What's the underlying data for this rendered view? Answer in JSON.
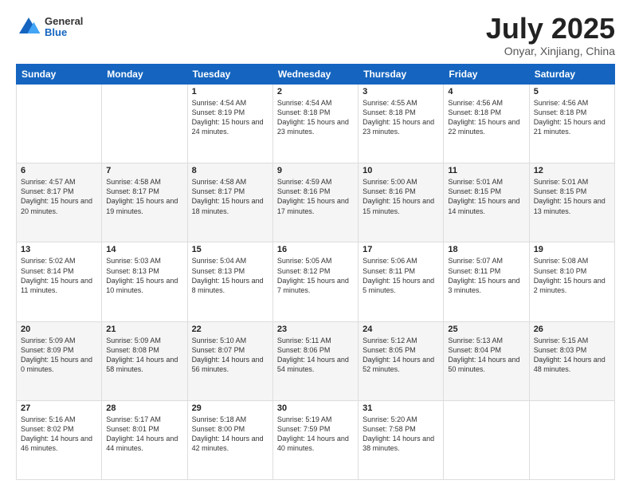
{
  "header": {
    "logo_general": "General",
    "logo_blue": "Blue",
    "month_title": "July 2025",
    "location": "Onyar, Xinjiang, China"
  },
  "weekdays": [
    "Sunday",
    "Monday",
    "Tuesday",
    "Wednesday",
    "Thursday",
    "Friday",
    "Saturday"
  ],
  "weeks": [
    [
      {
        "day": "",
        "info": ""
      },
      {
        "day": "",
        "info": ""
      },
      {
        "day": "1",
        "info": "Sunrise: 4:54 AM\nSunset: 8:19 PM\nDaylight: 15 hours and 24 minutes."
      },
      {
        "day": "2",
        "info": "Sunrise: 4:54 AM\nSunset: 8:18 PM\nDaylight: 15 hours and 23 minutes."
      },
      {
        "day": "3",
        "info": "Sunrise: 4:55 AM\nSunset: 8:18 PM\nDaylight: 15 hours and 23 minutes."
      },
      {
        "day": "4",
        "info": "Sunrise: 4:56 AM\nSunset: 8:18 PM\nDaylight: 15 hours and 22 minutes."
      },
      {
        "day": "5",
        "info": "Sunrise: 4:56 AM\nSunset: 8:18 PM\nDaylight: 15 hours and 21 minutes."
      }
    ],
    [
      {
        "day": "6",
        "info": "Sunrise: 4:57 AM\nSunset: 8:17 PM\nDaylight: 15 hours and 20 minutes."
      },
      {
        "day": "7",
        "info": "Sunrise: 4:58 AM\nSunset: 8:17 PM\nDaylight: 15 hours and 19 minutes."
      },
      {
        "day": "8",
        "info": "Sunrise: 4:58 AM\nSunset: 8:17 PM\nDaylight: 15 hours and 18 minutes."
      },
      {
        "day": "9",
        "info": "Sunrise: 4:59 AM\nSunset: 8:16 PM\nDaylight: 15 hours and 17 minutes."
      },
      {
        "day": "10",
        "info": "Sunrise: 5:00 AM\nSunset: 8:16 PM\nDaylight: 15 hours and 15 minutes."
      },
      {
        "day": "11",
        "info": "Sunrise: 5:01 AM\nSunset: 8:15 PM\nDaylight: 15 hours and 14 minutes."
      },
      {
        "day": "12",
        "info": "Sunrise: 5:01 AM\nSunset: 8:15 PM\nDaylight: 15 hours and 13 minutes."
      }
    ],
    [
      {
        "day": "13",
        "info": "Sunrise: 5:02 AM\nSunset: 8:14 PM\nDaylight: 15 hours and 11 minutes."
      },
      {
        "day": "14",
        "info": "Sunrise: 5:03 AM\nSunset: 8:13 PM\nDaylight: 15 hours and 10 minutes."
      },
      {
        "day": "15",
        "info": "Sunrise: 5:04 AM\nSunset: 8:13 PM\nDaylight: 15 hours and 8 minutes."
      },
      {
        "day": "16",
        "info": "Sunrise: 5:05 AM\nSunset: 8:12 PM\nDaylight: 15 hours and 7 minutes."
      },
      {
        "day": "17",
        "info": "Sunrise: 5:06 AM\nSunset: 8:11 PM\nDaylight: 15 hours and 5 minutes."
      },
      {
        "day": "18",
        "info": "Sunrise: 5:07 AM\nSunset: 8:11 PM\nDaylight: 15 hours and 3 minutes."
      },
      {
        "day": "19",
        "info": "Sunrise: 5:08 AM\nSunset: 8:10 PM\nDaylight: 15 hours and 2 minutes."
      }
    ],
    [
      {
        "day": "20",
        "info": "Sunrise: 5:09 AM\nSunset: 8:09 PM\nDaylight: 15 hours and 0 minutes."
      },
      {
        "day": "21",
        "info": "Sunrise: 5:09 AM\nSunset: 8:08 PM\nDaylight: 14 hours and 58 minutes."
      },
      {
        "day": "22",
        "info": "Sunrise: 5:10 AM\nSunset: 8:07 PM\nDaylight: 14 hours and 56 minutes."
      },
      {
        "day": "23",
        "info": "Sunrise: 5:11 AM\nSunset: 8:06 PM\nDaylight: 14 hours and 54 minutes."
      },
      {
        "day": "24",
        "info": "Sunrise: 5:12 AM\nSunset: 8:05 PM\nDaylight: 14 hours and 52 minutes."
      },
      {
        "day": "25",
        "info": "Sunrise: 5:13 AM\nSunset: 8:04 PM\nDaylight: 14 hours and 50 minutes."
      },
      {
        "day": "26",
        "info": "Sunrise: 5:15 AM\nSunset: 8:03 PM\nDaylight: 14 hours and 48 minutes."
      }
    ],
    [
      {
        "day": "27",
        "info": "Sunrise: 5:16 AM\nSunset: 8:02 PM\nDaylight: 14 hours and 46 minutes."
      },
      {
        "day": "28",
        "info": "Sunrise: 5:17 AM\nSunset: 8:01 PM\nDaylight: 14 hours and 44 minutes."
      },
      {
        "day": "29",
        "info": "Sunrise: 5:18 AM\nSunset: 8:00 PM\nDaylight: 14 hours and 42 minutes."
      },
      {
        "day": "30",
        "info": "Sunrise: 5:19 AM\nSunset: 7:59 PM\nDaylight: 14 hours and 40 minutes."
      },
      {
        "day": "31",
        "info": "Sunrise: 5:20 AM\nSunset: 7:58 PM\nDaylight: 14 hours and 38 minutes."
      },
      {
        "day": "",
        "info": ""
      },
      {
        "day": "",
        "info": ""
      }
    ]
  ]
}
